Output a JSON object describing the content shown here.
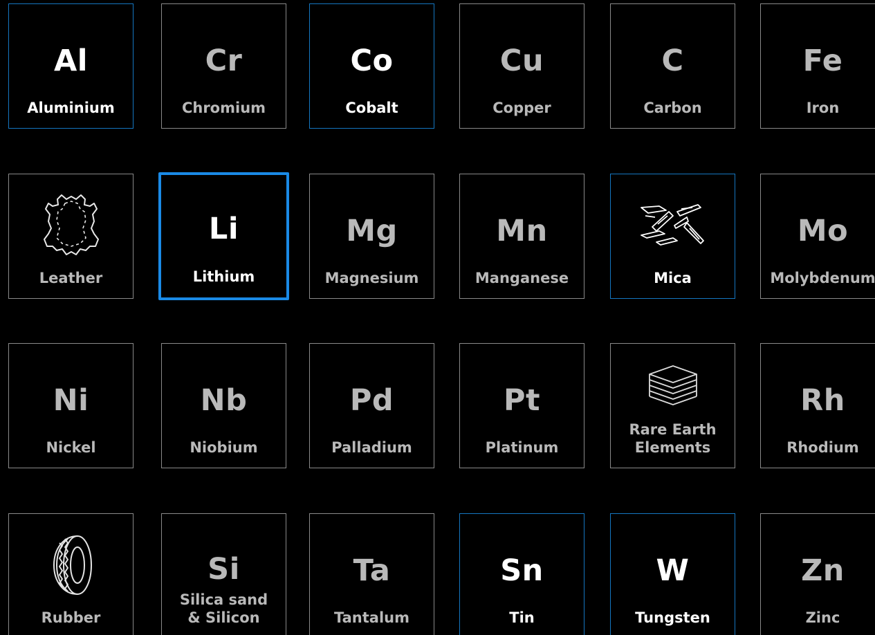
{
  "tiles": [
    {
      "symbol": "Al",
      "name": "Aluminium",
      "state": "accent-bright"
    },
    {
      "symbol": "Cr",
      "name": "Chromium",
      "state": "muted"
    },
    {
      "symbol": "Co",
      "name": "Cobalt",
      "state": "accent-bright"
    },
    {
      "symbol": "Cu",
      "name": "Copper",
      "state": "muted"
    },
    {
      "symbol": "C",
      "name": "Carbon",
      "state": "muted"
    },
    {
      "symbol": "Fe",
      "name": "Iron",
      "state": "muted"
    },
    {
      "icon": "leather-hide-icon",
      "name": "Leather",
      "state": "muted"
    },
    {
      "symbol": "Li",
      "name": "Lithium",
      "state": "selected"
    },
    {
      "symbol": "Mg",
      "name": "Magnesium",
      "state": "muted"
    },
    {
      "symbol": "Mn",
      "name": "Manganese",
      "state": "muted"
    },
    {
      "icon": "mica-flakes-icon",
      "name": "Mica",
      "state": "accent-bright"
    },
    {
      "symbol": "Mo",
      "name": "Molybdenum",
      "state": "muted"
    },
    {
      "symbol": "Ni",
      "name": "Nickel",
      "state": "muted"
    },
    {
      "symbol": "Nb",
      "name": "Niobium",
      "state": "muted"
    },
    {
      "symbol": "Pd",
      "name": "Palladium",
      "state": "muted"
    },
    {
      "symbol": "Pt",
      "name": "Platinum",
      "state": "muted"
    },
    {
      "icon": "stacked-layers-icon",
      "name_lines": [
        "Rare Earth",
        "Elements"
      ],
      "state": "muted"
    },
    {
      "symbol": "Rh",
      "name": "Rhodium",
      "state": "muted"
    },
    {
      "icon": "tire-icon",
      "name": "Rubber",
      "state": "muted"
    },
    {
      "symbol": "Si",
      "name_lines": [
        "Silica sand",
        "& Silicon"
      ],
      "state": "muted"
    },
    {
      "symbol": "Ta",
      "name": "Tantalum",
      "state": "muted"
    },
    {
      "symbol": "Sn",
      "name": "Tin",
      "state": "accent-bright"
    },
    {
      "symbol": "W",
      "name": "Tungsten",
      "state": "accent-bright"
    },
    {
      "symbol": "Zn",
      "name": "Zinc",
      "state": "muted"
    }
  ],
  "colors": {
    "background": "#000000",
    "border": "#8a8a8a",
    "accent_border": "#1577c2",
    "selected_border": "#1a8ae6",
    "muted_text": "#b9b9b9",
    "bright_text": "#ffffff"
  }
}
